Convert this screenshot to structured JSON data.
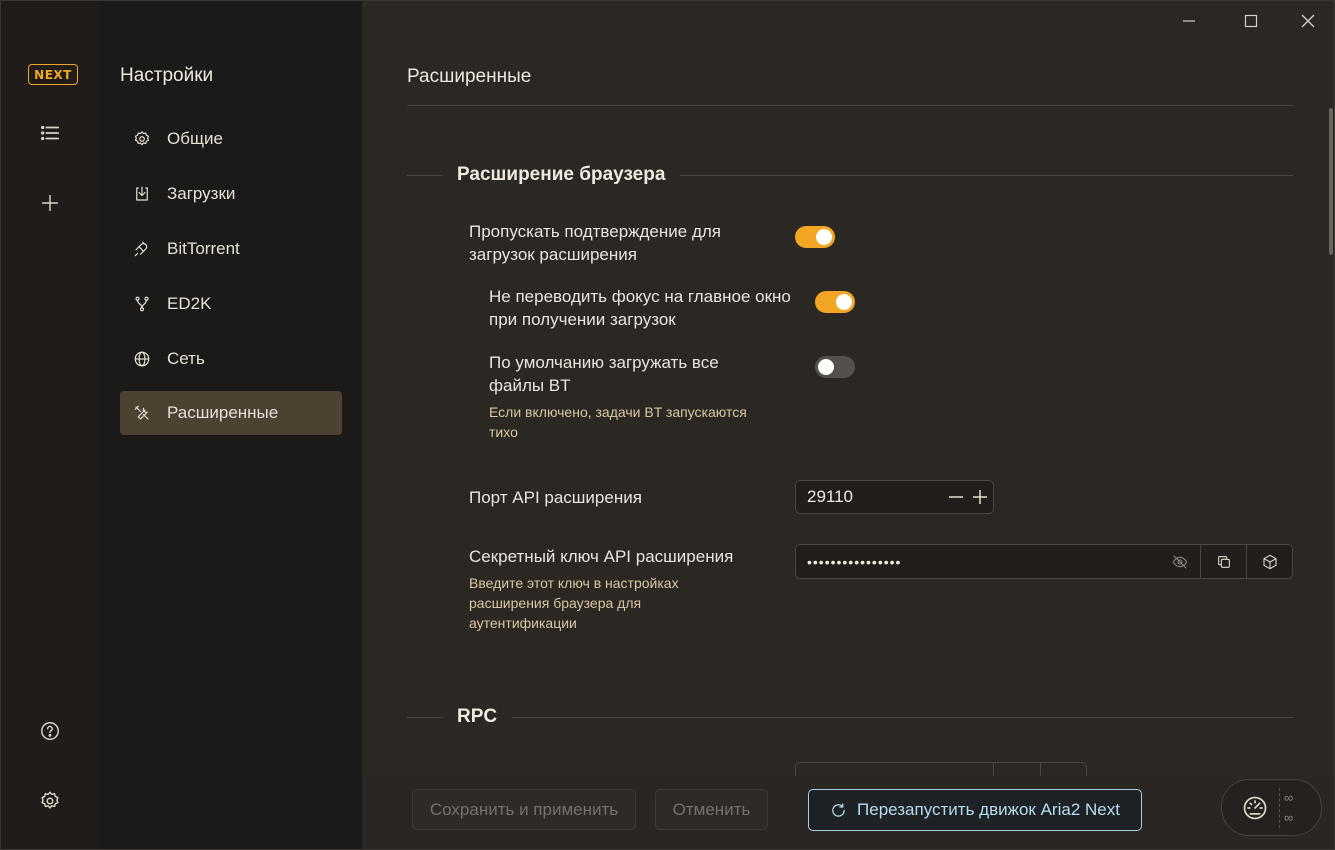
{
  "app": {
    "logo_text": "NEXT"
  },
  "rail": {
    "items": [
      {
        "name": "task-list",
        "icon": "list-icon"
      },
      {
        "name": "add-task",
        "icon": "plus-icon"
      },
      {
        "name": "help",
        "icon": "help-icon"
      },
      {
        "name": "settings",
        "icon": "gear-icon"
      }
    ]
  },
  "nav": {
    "title": "Настройки",
    "items": [
      {
        "label": "Общие",
        "icon": "gear-icon"
      },
      {
        "label": "Загрузки",
        "icon": "download-icon"
      },
      {
        "label": "BitTorrent",
        "icon": "magnet-icon"
      },
      {
        "label": "ED2K",
        "icon": "fork-icon"
      },
      {
        "label": "Сеть",
        "icon": "globe-icon"
      },
      {
        "label": "Расширенные",
        "icon": "tools-icon",
        "active": true
      }
    ]
  },
  "page": {
    "title": "Расширенные",
    "sections": {
      "browser_ext": {
        "title": "Расширение браузера",
        "skip_confirm": {
          "label": "Пропускать подтверждение для загрузок расширения",
          "on": true
        },
        "no_focus": {
          "label": "Не переводить фокус на главное окно при получении загрузок",
          "on": true
        },
        "bt_all": {
          "label": "По умолчанию загружать все файлы BT",
          "hint": "Если включено, задачи BT запускаются тихо",
          "on": false
        },
        "api_port": {
          "label": "Порт API расширения",
          "value": "29110"
        },
        "api_secret": {
          "label": "Секретный ключ API расширения",
          "value": "••••••••••••••••",
          "hint": "Введите этот ключ в настройках расширения браузера для аутентификации"
        }
      },
      "rpc": {
        "title": "RPC"
      }
    }
  },
  "footer": {
    "save_label": "Сохранить и применить",
    "cancel_label": "Отменить",
    "restart_label": "Перезапустить движок Aria2 Next",
    "upload_rate": "∞",
    "download_rate": "∞"
  },
  "colors": {
    "accent": "#f2a623",
    "restart_border": "#a7cfe3",
    "active_nav_bg": "#4b4232"
  }
}
